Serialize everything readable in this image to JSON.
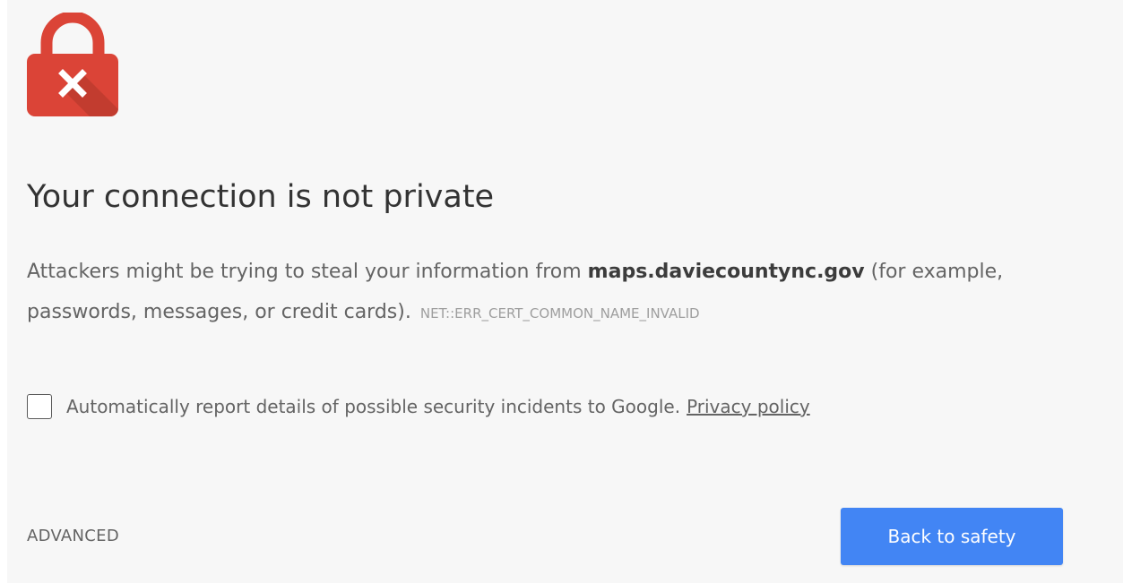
{
  "icon": {
    "name": "lock-error-icon",
    "color": "#db4437",
    "shadow_color": "#b93a2e"
  },
  "main": {
    "heading": "Your connection is not private",
    "explanation_before": "Attackers might be trying to steal your information from ",
    "host": "maps.daviecountync.gov",
    "explanation_after": " (for example, passwords, messages, or credit cards).",
    "error_code": "NET::ERR_CERT_COMMON_NAME_INVALID"
  },
  "report": {
    "checked": false,
    "text": "Automatically report details of possible security incidents to Google.",
    "privacy_link": "Privacy policy"
  },
  "buttons": {
    "advanced": "ADVANCED",
    "back_to_safety": "Back to safety"
  },
  "colors": {
    "background": "#f7f7f7",
    "primary_button": "#4285f4",
    "heading_text": "#333333",
    "body_text": "#646464",
    "error_code_text": "#9e9e9e"
  }
}
